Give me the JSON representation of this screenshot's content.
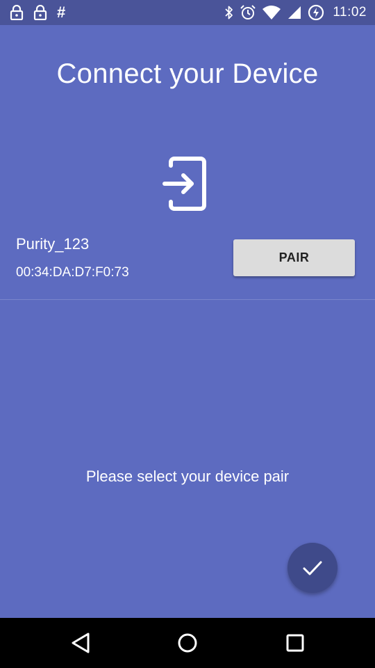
{
  "status_bar": {
    "left_icons": [
      "lock-icon",
      "lock-icon",
      "hash-icon"
    ],
    "hash_glyph": "#",
    "right_icons": [
      "bluetooth-icon",
      "alarm-icon",
      "wifi-icon",
      "signal-icon",
      "battery-charging-icon"
    ],
    "time": "11:02"
  },
  "title": "Connect your Device",
  "device_icon": "login-device-icon",
  "device": {
    "name": "Purity_123",
    "mac": "00:34:DA:D7:F0:73"
  },
  "pair_button_label": "PAIR",
  "hint": "Please select your device pair",
  "fab_icon": "check-icon",
  "nav_bar": {
    "icons": [
      "back-icon",
      "home-icon",
      "recents-icon"
    ]
  },
  "colors": {
    "background": "#5d6bc0",
    "status_bar": "#4a5499",
    "fab": "#3f4a8a",
    "pair_button": "#dcdcdc"
  }
}
